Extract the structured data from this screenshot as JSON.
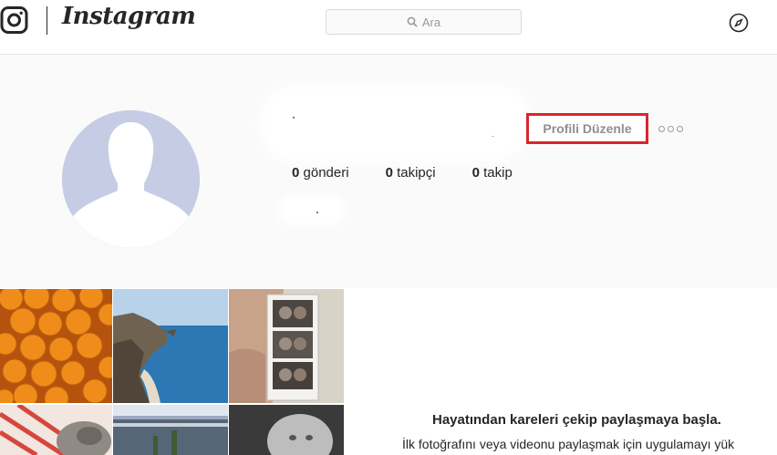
{
  "header": {
    "brand": "Instagram",
    "search_placeholder": "Ara",
    "icons": [
      "instagram-camera-icon",
      "search-icon",
      "compass-icon"
    ]
  },
  "profile": {
    "edit_button": "Profili Düzenle",
    "stats": [
      {
        "count": "0",
        "label": "gönderi"
      },
      {
        "count": "0",
        "label": "takipçi"
      },
      {
        "count": "0",
        "label": "takip"
      }
    ]
  },
  "empty_state": {
    "headline": "Hayatından kareleri çekip paylaşmaya başla.",
    "subtext": "İlk fotoğrafını veya videonu paylaşmak için uygulamayı yük"
  },
  "colors": {
    "highlight_border": "#d9252c",
    "avatar_bg": "#c6cce4",
    "page_bg": "#fafafa"
  }
}
